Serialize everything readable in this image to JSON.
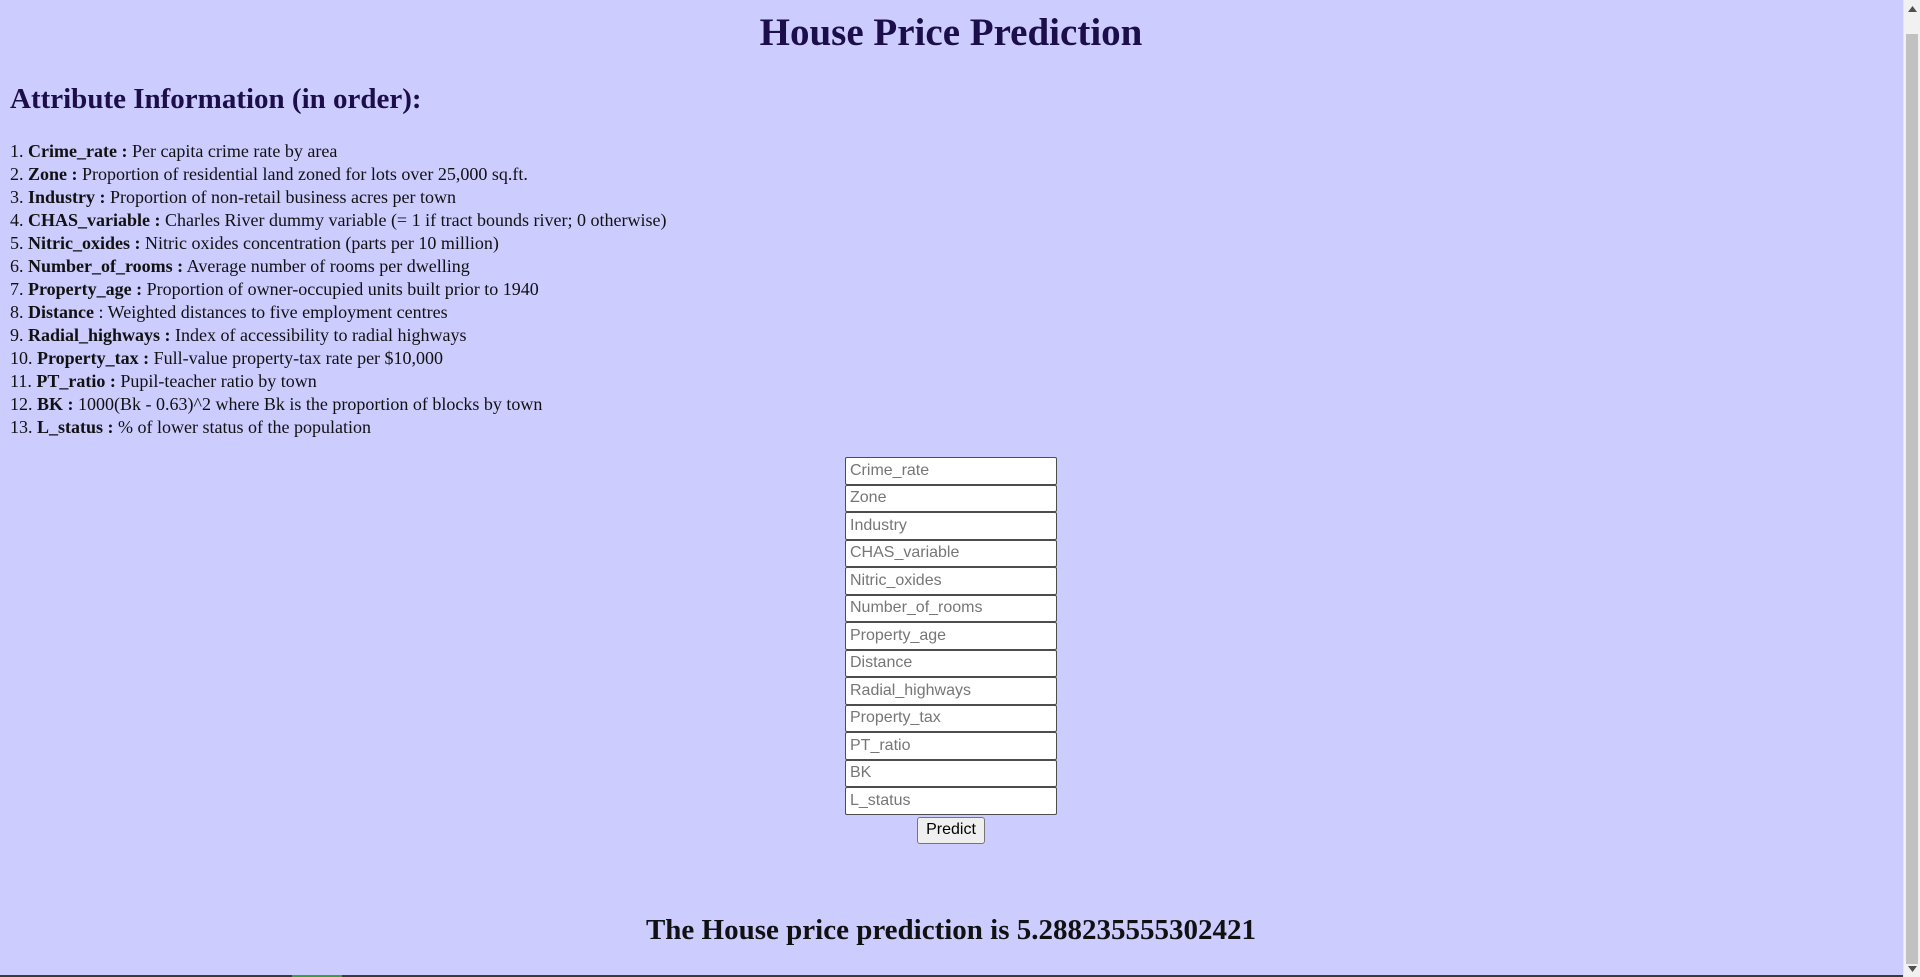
{
  "header": {
    "title": "House Price Prediction"
  },
  "attributes": {
    "heading": "Attribute Information (in order):",
    "items": [
      {
        "num": "1.",
        "name": "Crime_rate :",
        "desc": " Per capita crime rate by area"
      },
      {
        "num": "2.",
        "name": "Zone :",
        "desc": " Proportion of residential land zoned for lots over 25,000 sq.ft."
      },
      {
        "num": "3.",
        "name": "Industry :",
        "desc": " Proportion of non-retail business acres per town"
      },
      {
        "num": "4.",
        "name": "CHAS_variable :",
        "desc": " Charles River dummy variable (= 1 if tract bounds river; 0 otherwise)"
      },
      {
        "num": "5.",
        "name": "Nitric_oxides :",
        "desc": " Nitric oxides concentration (parts per 10 million)"
      },
      {
        "num": "6.",
        "name": "Number_of_rooms :",
        "desc": " Average number of rooms per dwelling"
      },
      {
        "num": "7.",
        "name": "Property_age :",
        "desc": " Proportion of owner-occupied units built prior to 1940"
      },
      {
        "num": "8.",
        "name": "Distance",
        "desc": " : Weighted distances to five employment centres"
      },
      {
        "num": "9.",
        "name": "Radial_highways :",
        "desc": " Index of accessibility to radial highways"
      },
      {
        "num": "10.",
        "name": "Property_tax :",
        "desc": " Full-value property-tax rate per $10,000"
      },
      {
        "num": "11.",
        "name": "PT_ratio :",
        "desc": " Pupil-teacher ratio by town"
      },
      {
        "num": "12.",
        "name": "BK :",
        "desc": " 1000(Bk - 0.63)^2 where Bk is the proportion of blocks by town"
      },
      {
        "num": "13.",
        "name": "L_status :",
        "desc": " % of lower status of the population"
      }
    ]
  },
  "form": {
    "fields": [
      {
        "placeholder": "Crime_rate",
        "value": ""
      },
      {
        "placeholder": "Zone",
        "value": ""
      },
      {
        "placeholder": "Industry",
        "value": ""
      },
      {
        "placeholder": "CHAS_variable",
        "value": ""
      },
      {
        "placeholder": "Nitric_oxides",
        "value": ""
      },
      {
        "placeholder": "Number_of_rooms",
        "value": ""
      },
      {
        "placeholder": "Property_age",
        "value": ""
      },
      {
        "placeholder": "Distance",
        "value": ""
      },
      {
        "placeholder": "Radial_highways",
        "value": ""
      },
      {
        "placeholder": "Property_tax",
        "value": ""
      },
      {
        "placeholder": "PT_ratio",
        "value": ""
      },
      {
        "placeholder": "BK",
        "value": ""
      },
      {
        "placeholder": "L_status",
        "value": ""
      }
    ],
    "submit_label": "Predict"
  },
  "result": {
    "text": "The House price prediction is 5.288235555302421"
  },
  "colors": {
    "background": "#ccccfe",
    "heading": "#1c0e4a"
  },
  "icons": {
    "scroll_up": "triangle-up-icon",
    "scroll_down": "triangle-down-icon"
  }
}
